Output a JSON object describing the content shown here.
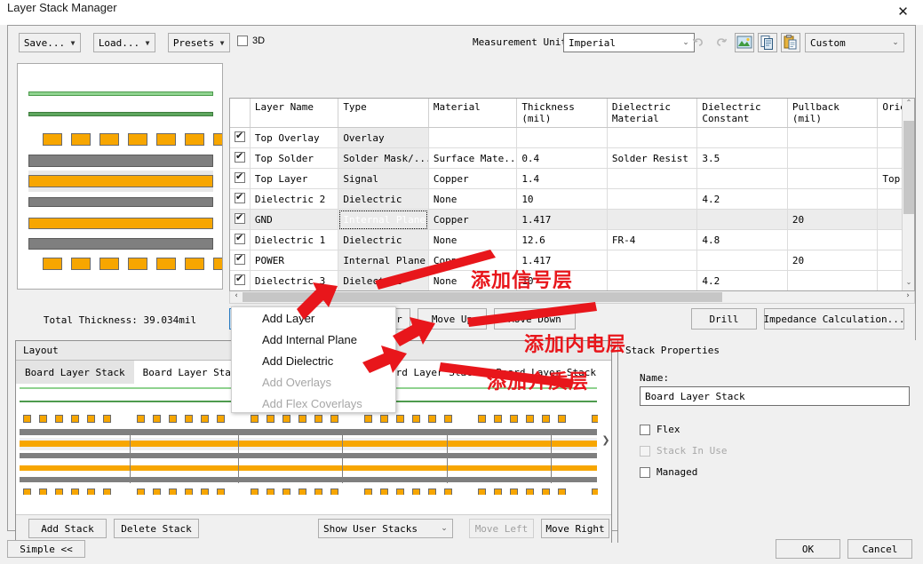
{
  "window": {
    "title": "Layer Stack Manager",
    "close_icon": "close-icon"
  },
  "toolbar": {
    "save": "Save...",
    "load": "Load...",
    "presets": "Presets",
    "three_d": "3D",
    "measurement_unit_label": "Measurement Unit",
    "measurement_unit_value": "Imperial",
    "undo_icon": "undo-icon",
    "redo_icon": "redo-icon",
    "stackup_icon": "stackup-image-icon",
    "copy_icon": "copy-icon",
    "paste_icon": "paste-icon",
    "preset_value": "Custom"
  },
  "table": {
    "columns": [
      "",
      "Layer Name",
      "Type",
      "Material",
      "Thickness\n(mil)",
      "Dielectric\nMaterial",
      "Dielectric\nConstant",
      "Pullback (mil)",
      "Orien"
    ],
    "columns_flat": [
      "",
      "Layer Name",
      "Type",
      "Material",
      "Thickness",
      "Dielectric",
      "Dielectric",
      "Pullback (mil)",
      "Orien"
    ],
    "col_thickness_l1": "Thickness",
    "col_thickness_l2": "(mil)",
    "col_dielmat_l1": "Dielectric",
    "col_dielmat_l2": "Material",
    "col_dielconst_l1": "Dielectric",
    "col_dielconst_l2": "Constant",
    "col_layer_name": "Layer Name",
    "col_type": "Type",
    "col_material": "Material",
    "col_pullback": "Pullback (mil)",
    "col_orientation": "Orien",
    "rows": [
      {
        "checked": true,
        "name": "Top Overlay",
        "type": "Overlay",
        "material": "",
        "thickness": "",
        "diel_material": "",
        "diel_const": "",
        "pullback": "",
        "orientation": ""
      },
      {
        "checked": true,
        "name": "Top Solder",
        "type": "Solder Mask/...",
        "material": "Surface Mate...",
        "thickness": "0.4",
        "diel_material": "Solder Resist",
        "diel_const": "3.5",
        "pullback": "",
        "orientation": ""
      },
      {
        "checked": true,
        "name": "Top Layer",
        "type": "Signal",
        "material": "Copper",
        "thickness": "1.4",
        "diel_material": "",
        "diel_const": "",
        "pullback": "",
        "orientation": "Top"
      },
      {
        "checked": true,
        "name": "Dielectric 2",
        "type": "Dielectric",
        "material": "None",
        "thickness": "10",
        "diel_material": "",
        "diel_const": "4.2",
        "pullback": "",
        "orientation": ""
      },
      {
        "checked": true,
        "name": "GND",
        "type": "Internal Plane",
        "material": "Copper",
        "thickness": "1.417",
        "diel_material": "",
        "diel_const": "",
        "pullback": "20",
        "orientation": "",
        "selected": true
      },
      {
        "checked": true,
        "name": "Dielectric 1",
        "type": "Dielectric",
        "material": "None",
        "thickness": "12.6",
        "diel_material": "FR-4",
        "diel_const": "4.8",
        "pullback": "",
        "orientation": ""
      },
      {
        "checked": true,
        "name": "POWER",
        "type": "Internal Plane",
        "material": "Copper",
        "thickness": "1.417",
        "diel_material": "",
        "diel_const": "",
        "pullback": "20",
        "orientation": ""
      },
      {
        "checked": true,
        "name": "Dielectric 3",
        "type": "Dielectric",
        "material": "None",
        "thickness": "10",
        "diel_material": "",
        "diel_const": "4.2",
        "pullback": "",
        "orientation": ""
      }
    ]
  },
  "stack_preview": {
    "total_thickness": "Total Thickness: 39.034mil"
  },
  "layer_actions": {
    "add_layer": "Add Layer",
    "add_layer_arrow": "chevron-down-icon",
    "delete_layer": "Delete Layer",
    "move_up": "Move Up",
    "move_down": "Move Down",
    "drill": "Drill",
    "impedance": "Impedance Calculation..."
  },
  "dropdown": {
    "items": [
      {
        "label": "Add Layer",
        "enabled": true
      },
      {
        "label": "Add Internal Plane",
        "enabled": true
      },
      {
        "label": "Add Dielectric",
        "enabled": true
      },
      {
        "label": "Add Overlays",
        "enabled": false
      },
      {
        "label": "Add Flex Coverlays",
        "enabled": false
      }
    ]
  },
  "layout_panel": {
    "header": "Layout",
    "tabs": [
      {
        "label": "Board Layer Stack",
        "active": true
      },
      {
        "label": "Board Layer Stack",
        "active": false
      },
      {
        "label": "Board Layer Stack",
        "active": false
      },
      {
        "label": "Board Layer Stack",
        "active": false
      },
      {
        "label": "Board Layer Stack",
        "active": false
      },
      {
        "label": "Board Lay",
        "active": false
      }
    ],
    "add_stack": "Add Stack",
    "delete_stack": "Delete Stack",
    "show_filter": "Show User Stacks",
    "move_left": "Move Left",
    "move_right": "Move Right",
    "next_icon": "chevron-right-icon"
  },
  "stack_properties": {
    "header": "Stack Properties",
    "name_label": "Name:",
    "name_value": "Board Layer Stack",
    "flex": {
      "label": "Flex",
      "checked": false,
      "enabled": true
    },
    "stack_in_use": {
      "label": "Stack In Use",
      "checked": false,
      "enabled": false
    },
    "managed": {
      "label": "Managed",
      "checked": false,
      "enabled": true
    }
  },
  "footer": {
    "simple": "Simple <<",
    "ok": "OK",
    "cancel": "Cancel"
  },
  "annotations": [
    {
      "text": "添加信号层",
      "note": "add signal layer"
    },
    {
      "text": "添加内电层",
      "note": "add internal plane layer"
    },
    {
      "text": "添加介质层",
      "note": "add dielectric layer"
    }
  ],
  "colors": {
    "accent": "#1464b4",
    "annotation_red": "#e8161b",
    "copper": "#f7a600",
    "plane_gray": "#7f7f7f",
    "overlay_green_light": "#8fd28f",
    "overlay_green_dark": "#4e9b4e",
    "window_bg": "#f0f0f0"
  }
}
